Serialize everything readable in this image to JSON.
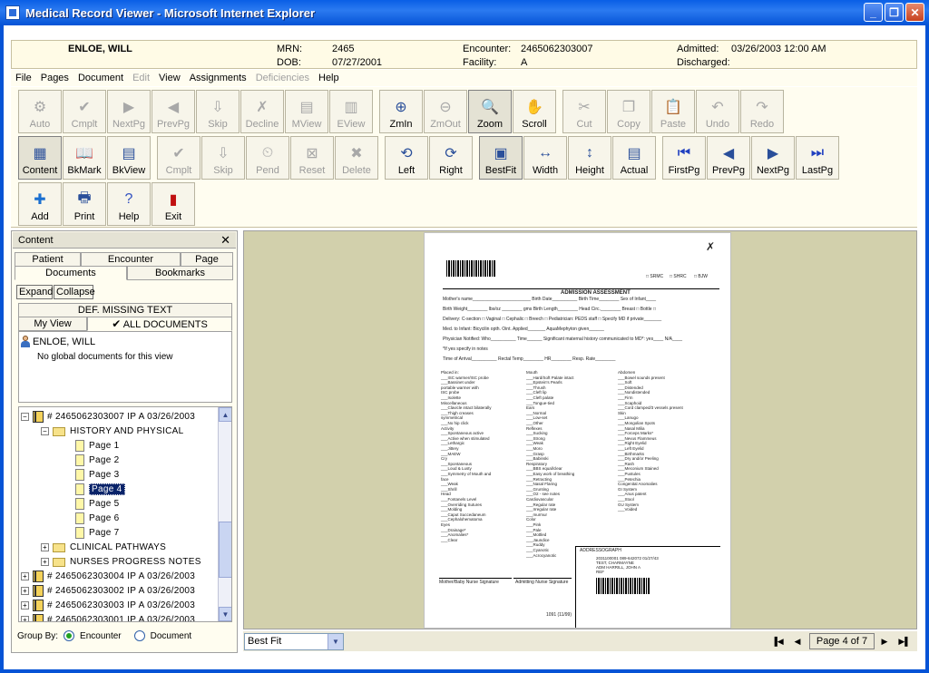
{
  "window": {
    "title": "Medical Record Viewer - Microsoft Internet Explorer"
  },
  "patient": {
    "name": "ENLOE, WILL",
    "mrn_label": "MRN:",
    "mrn": "2465",
    "dob_label": "DOB:",
    "dob": "07/27/2001",
    "encounter_label": "Encounter:",
    "encounter": "2465062303007",
    "facility_label": "Facility:",
    "facility": "A",
    "admitted_label": "Admitted:",
    "admitted": "03/26/2003 12:00 AM",
    "discharged_label": "Discharged:",
    "discharged": ""
  },
  "menu": [
    {
      "label": "File",
      "enabled": true
    },
    {
      "label": "Pages",
      "enabled": true
    },
    {
      "label": "Document",
      "enabled": true
    },
    {
      "label": "Edit",
      "enabled": false
    },
    {
      "label": "View",
      "enabled": true
    },
    {
      "label": "Assignments",
      "enabled": true
    },
    {
      "label": "Deficiencies",
      "enabled": false
    },
    {
      "label": "Help",
      "enabled": true
    }
  ],
  "toolbar": {
    "row1": [
      {
        "label": "Auto",
        "icon": "auto-icon",
        "enabled": false
      },
      {
        "label": "Cmplt",
        "icon": "check-icon",
        "enabled": false
      },
      {
        "label": "NextPg",
        "icon": "next-page-icon",
        "enabled": false
      },
      {
        "label": "PrevPg",
        "icon": "prev-page-icon",
        "enabled": false
      },
      {
        "label": "Skip",
        "icon": "skip-icon",
        "enabled": false
      },
      {
        "label": "Decline",
        "icon": "decline-icon",
        "enabled": false
      },
      {
        "label": "MView",
        "icon": "mview-icon",
        "enabled": false
      },
      {
        "label": "EView",
        "icon": "eview-icon",
        "enabled": false
      },
      {
        "label": "ZmIn",
        "icon": "zoom-in-icon",
        "enabled": true
      },
      {
        "label": "ZmOut",
        "icon": "zoom-out-icon",
        "enabled": false
      },
      {
        "label": "Zoom",
        "icon": "zoom-icon",
        "enabled": true,
        "active": true
      },
      {
        "label": "Scroll",
        "icon": "hand-icon",
        "enabled": true
      },
      {
        "label": "Cut",
        "icon": "scissors-icon",
        "enabled": false
      },
      {
        "label": "Copy",
        "icon": "copy-icon",
        "enabled": false
      },
      {
        "label": "Paste",
        "icon": "paste-icon",
        "enabled": false
      },
      {
        "label": "Undo",
        "icon": "undo-icon",
        "enabled": false
      },
      {
        "label": "Redo",
        "icon": "redo-icon",
        "enabled": false
      }
    ],
    "row2": [
      {
        "label": "Content",
        "icon": "content-icon",
        "enabled": true,
        "active": true
      },
      {
        "label": "BkMark",
        "icon": "bookmark-icon",
        "enabled": true
      },
      {
        "label": "BkView",
        "icon": "bookview-icon",
        "enabled": true
      },
      {
        "label": "Cmplt",
        "icon": "check-icon",
        "enabled": false
      },
      {
        "label": "Skip",
        "icon": "skip-icon",
        "enabled": false
      },
      {
        "label": "Pend",
        "icon": "pend-icon",
        "enabled": false
      },
      {
        "label": "Reset",
        "icon": "reset-icon",
        "enabled": false
      },
      {
        "label": "Delete",
        "icon": "delete-icon",
        "enabled": false
      },
      {
        "label": "Left",
        "icon": "rotate-left-icon",
        "enabled": true
      },
      {
        "label": "Right",
        "icon": "rotate-right-icon",
        "enabled": true
      },
      {
        "label": "BestFit",
        "icon": "bestfit-icon",
        "enabled": true,
        "active": true
      },
      {
        "label": "Width",
        "icon": "fit-width-icon",
        "enabled": true
      },
      {
        "label": "Height",
        "icon": "fit-height-icon",
        "enabled": true
      },
      {
        "label": "Actual",
        "icon": "actual-size-icon",
        "enabled": true
      },
      {
        "label": "FirstPg",
        "icon": "first-page-icon",
        "enabled": true
      },
      {
        "label": "PrevPg",
        "icon": "prev-page-icon",
        "enabled": true
      },
      {
        "label": "NextPg",
        "icon": "next-page-icon",
        "enabled": true
      },
      {
        "label": "LastPg",
        "icon": "last-page-icon",
        "enabled": true
      }
    ],
    "row3": [
      {
        "label": "Add",
        "icon": "add-icon",
        "enabled": true
      },
      {
        "label": "Print",
        "icon": "printer-icon",
        "enabled": true
      },
      {
        "label": "Help",
        "icon": "help-icon",
        "enabled": true
      },
      {
        "label": "Exit",
        "icon": "exit-icon",
        "enabled": true
      }
    ]
  },
  "content_panel": {
    "title": "Content",
    "close": "✕",
    "tabs_row1": [
      "Patient",
      "Encounter",
      "Page"
    ],
    "tabs_row2": [
      "Documents",
      "Bookmarks"
    ],
    "expand": "Expand",
    "collapse": "Collapse",
    "subtabs_top": "DEF. MISSING TEXT",
    "subtabs": [
      "My View",
      "ALL DOCUMENTS"
    ],
    "checkmark": "✔",
    "patient_name": "ENLOE, WILL",
    "no_global": "No global documents for this view",
    "tree": [
      {
        "text": "# 2465062303007  IP  A  03/26/2003",
        "type": "encounter",
        "expanded": true
      },
      {
        "text": "HISTORY AND PHYSICAL",
        "type": "folder",
        "expanded": true
      },
      {
        "text": "Page 1",
        "type": "page"
      },
      {
        "text": "Page 2",
        "type": "page"
      },
      {
        "text": "Page 3",
        "type": "page"
      },
      {
        "text": "Page 4",
        "type": "page",
        "selected": true
      },
      {
        "text": "Page 5",
        "type": "page"
      },
      {
        "text": "Page 6",
        "type": "page"
      },
      {
        "text": "Page 7",
        "type": "page"
      },
      {
        "text": "CLINICAL PATHWAYS",
        "type": "folder",
        "expanded": false
      },
      {
        "text": "NURSES PROGRESS NOTES",
        "type": "folder",
        "expanded": false
      },
      {
        "text": "# 2465062303004  IP  A  03/26/2003",
        "type": "encounter",
        "expanded": false
      },
      {
        "text": "# 2465062303002  IP  A  03/26/2003",
        "type": "encounter",
        "expanded": false
      },
      {
        "text": "# 2465062303003  IP  A  03/26/2003",
        "type": "encounter",
        "expanded": false
      },
      {
        "text": "# 2465062303001  IP  A  03/26/2003",
        "type": "encounter",
        "expanded": false
      }
    ],
    "group_by_label": "Group By:",
    "group_by_options": [
      "Encounter",
      "Document"
    ],
    "group_by_selected": "Encounter"
  },
  "viewer": {
    "fit_select": "Best Fit",
    "page_indicator": "Page 4 of 7",
    "document": {
      "header_boxes": [
        "SRMC",
        "SHRC",
        "BJW"
      ],
      "title": "ADMISSION ASSESSMENT",
      "lines": [
        "Mother's name_______________________ Birth Date__________ Birth Time________ Sex of Infant____",
        "Birth Weight________ lbs/oz ________ gms Birth Length________ Head Circ.________ Breast □ Bottle □",
        "Delivery: C-section □ Vaginal □ Cephalic □ Breech □ Pediatrician: PEDS staff □ Specify MD if private_______",
        "Med. to Infant: Bicycilin opth. Oint. Applied_______ AquaMephyton given______",
        "Physician Notified: Who__________ Time______ Significant maternal history communicated to MD*: yes____ N/A____",
        "*If yes specify in notes",
        "Time of Arrival__________ Rectal Temp________ HR________ Resp. Rate________"
      ],
      "col1": [
        "Placed in:",
        "___ISC warmer/ISC probe",
        "___Bassinet under",
        "   portable warmer with",
        "   ISC probe",
        "___Isolette",
        "Miscellaneous",
        "___Clavicle intact bilaterally",
        "___Thigh creases",
        "   symmetrical",
        "___No hip click",
        "Activity",
        "___Spontaneous active",
        "___Active when stimulated",
        "___Lethargic",
        "___Jittery",
        "___MAEW",
        "Cry",
        "___Spontaneous",
        "___Loud & Lusty",
        "___Symmetry of Mouth and",
        "   face",
        "___Weak",
        "___Shrill",
        "Head",
        "___Fontanels Level",
        "___Overriding Sutures",
        "___Molding",
        "___Caput Succedaneum",
        "___Cephalohematoma",
        "Eyes",
        "___Drainage*",
        "___Anomalies*",
        "___Clear"
      ],
      "col2": [
        "Mouth",
        "___Hard/Soft Palate intact",
        "___Epstein's Pearls",
        "___Thrush",
        "___Cleft lip",
        "___Cleft palate",
        "___Tongue-tied",
        "Ears",
        "___Normal",
        "___Low-set",
        "___Other",
        "Reflexes",
        "___Sucking",
        "___Strong",
        "___Weak",
        "___Moro",
        "___Grasp",
        "___Babinski",
        "Respiratory",
        "___BBS equal/clear",
        "___Easy work of breathing",
        "___Retracting",
        "___Nasal Flaring",
        "___Grunting",
        "___O2 - see notes",
        "Cardiovascular",
        "___Regular rate",
        "___Irregular rate",
        "___murmur",
        "Color",
        "___Pink",
        "___Pale",
        "___Mottled",
        "___Jaundice",
        "___Ruddy",
        "___Cyanotic",
        "___Acrocyanotic"
      ],
      "col3": [
        "Abdomen",
        "___Bowel sounds present",
        "___Soft",
        "___Distended",
        "___Nondistended",
        "___Firm",
        "___Scaphoid",
        "___Cord clamped/3 vessels present",
        "Skin",
        "___Lanugo",
        "___Mongolian Spots",
        "___Nasal Milia",
        "___Forceps Marks*",
        "___Nevus Flammeus",
        "___Right Eyelid",
        "___Left Eyelid",
        "___Birthmarks",
        "___Dry and/or Peeling",
        "___Rash",
        "___Meconium Stained",
        "___Pustules",
        "___Petechia",
        "Congenital Anomalies",
        "GI System",
        "___Anus patent",
        "___Stool",
        "GU System",
        "___Voided"
      ],
      "addressograph_label": "ADDRESSOGRAPH",
      "addressograph_lines": [
        "2031100001    089-642072    01/27/43",
        "TEST, CHARMAYNE",
        "ADM    HARRILL, JOHN A",
        "REF"
      ],
      "signatures": [
        "Mother/Baby Nurse Signature",
        "Admitting Nurse Signature"
      ],
      "form_number": "1091 (11/99)"
    }
  },
  "colors": {
    "titlebar": "#0553D6",
    "header_bg": "#FFFBE6",
    "selection": "#0A246A",
    "viewer_bg": "#D2D0AC"
  }
}
